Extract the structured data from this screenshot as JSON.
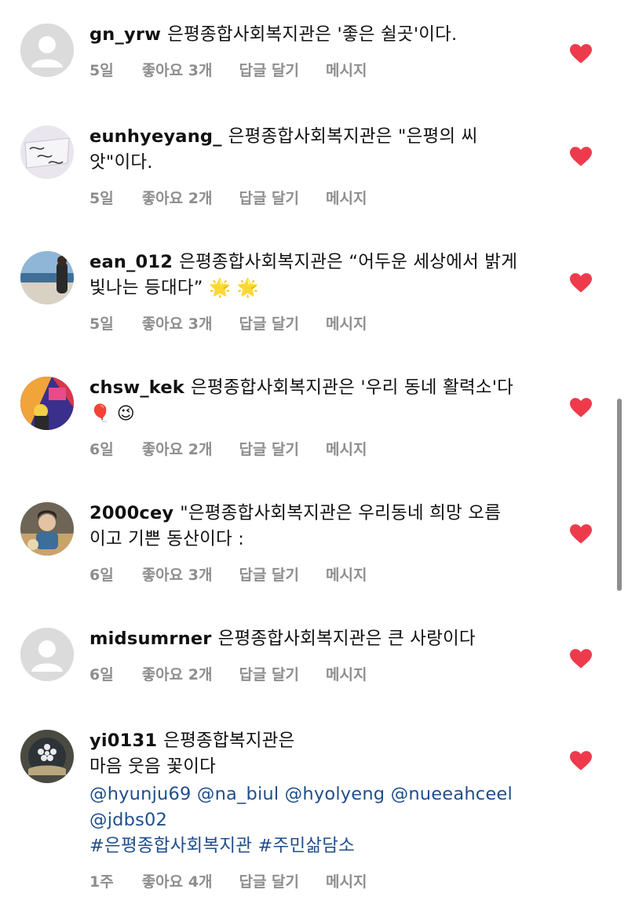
{
  "meta_labels": {
    "likes_prefix": "좋아요",
    "reply": "답글 달기",
    "message": "메시지"
  },
  "colors": {
    "heart": "#ed3b4c",
    "mention": "#1f4e8c",
    "meta": "#8e8e8e"
  },
  "comments": [
    {
      "username": "gn_yrw",
      "lines": [
        "은평종합사회복지관은 '좋은 쉴곳'이다."
      ],
      "time": "5일",
      "likes": "좋아요 3개",
      "avatar": "default-avatar"
    },
    {
      "username": "eunhyeyang_",
      "lines": [
        "은평종합사회복지관은 \"은평의 씨",
        "앗\"이다."
      ],
      "time": "5일",
      "likes": "좋아요 2개",
      "avatar": "handwriting-avatar"
    },
    {
      "username": "ean_012",
      "lines": [
        "은평종합사회복지관은 “어두운 세상에서 밝게",
        "빛나는 등대다” 🌟 🌟"
      ],
      "time": "5일",
      "likes": "좋아요 3개",
      "avatar": "beach-avatar"
    },
    {
      "username": "chsw_kek",
      "lines": [
        "은평종합사회복지관은 '우리 동네 활력소'다",
        "🎈 😉"
      ],
      "time": "6일",
      "likes": "좋아요 2개",
      "avatar": "colorful-avatar"
    },
    {
      "username": "2000cey",
      "lines": [
        "\"은평종합사회복지관은 우리동네 희망 오름",
        "이고 기쁜 동산이다 :"
      ],
      "time": "6일",
      "likes": "좋아요 3개",
      "avatar": "person-avatar"
    },
    {
      "username": "midsumrner",
      "lines": [
        "은평종합사회복지관은 큰 사랑이다"
      ],
      "time": "6일",
      "likes": "좋아요 2개",
      "avatar": "default-avatar"
    },
    {
      "username": "yi0131",
      "lines": [
        "은평종합복지관은",
        "마음 웃음 꽃이다"
      ],
      "mentions": [
        "@hyunju69 @na_biul @hyolyeng @nueeahceel",
        "@jdbs02",
        "#은평종합사회복지관 #주민삶담소"
      ],
      "time": "1주",
      "likes": "좋아요 4개",
      "avatar": "flower-avatar"
    }
  ]
}
